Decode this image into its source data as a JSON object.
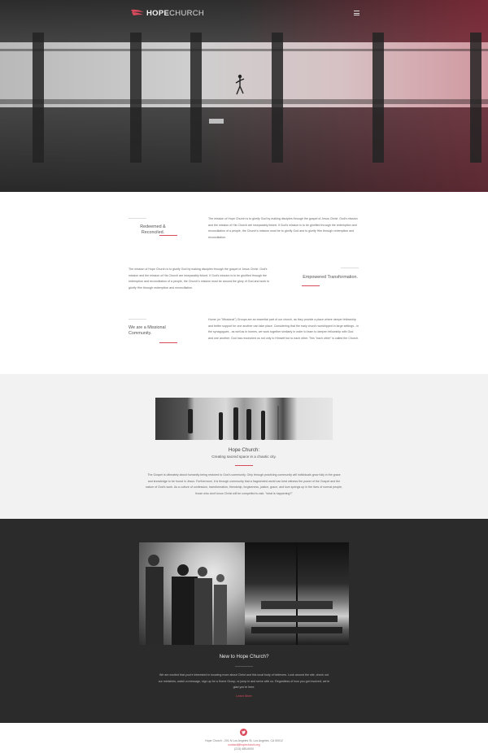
{
  "brand": {
    "name_bold": "HOPE",
    "name_light": "CHURCH",
    "accent": "#d94a5c"
  },
  "nav": {
    "menu_icon": "hamburger-menu-icon"
  },
  "mission": [
    {
      "heading": "Redeemed & Reconciled.",
      "body": "The mission of Hope Church is to glorify God by making disciples through the gospel of Jesus Christ. God's mission and the mission of His Church are inseparably linked. If God's mission is to be glorified through the redemption and reconciliation of a people, the Church's mission must be to glorify God and to glorify Him through redemption and reconciliation."
    },
    {
      "heading": "Empowered Transformation.",
      "body": "The mission of Hope Church is to glorify God by making disciples through the gospel of Jesus Christ. God's mission and the mission of His Church are inseparably linked. If God's mission is to be glorified through the redemption and reconciliation of a people, the Church's mission must be around the glory of God and work to glorify Him through redemption and reconciliation."
    },
    {
      "heading": "We are a Missional Community.",
      "body": "Home (or \"Missional\") Groups are an essential part of our church, as they provide a place where deeper fellowship and better support for one another can take place. Considering that the early church worshipped in large settings - in the synagogues - as well as in homes, we work together similarly in order to learn to deepen fellowship with God and one another. God has reconciled us not only to Himself but to each other. This \"each other\" is called the Church."
    }
  ],
  "hope": {
    "title": "Hope Church:",
    "subtitle": "Creating sacred space in a chaotic city.",
    "body": "The Gospel is ultimately about humanity being restored to God's community. Only through practicing community will individuals grow fully in the grace and knowledge to be found in Jesus. Furthermore, it is through community that a fragmented world can best witness the power of the Gospel and the nature of God's work. As a culture of confession, transformation, friendship, forgiveness, justice, grace, and love springs up in the lives of normal people, those who don't know Christ will be compelled to ask: \"what is happening?\""
  },
  "new": {
    "title": "New to Hope Church?",
    "body": "We are excited that you're interested in knowing more about Christ and this local body of believers. Look around the site, check out our ministries, watch a message, sign up for a Home Group, or jump in and serve with us. Regardless of how you got involved, we're glad you're here.",
    "link": "Learn More"
  },
  "footer": {
    "social_icon": "twitter-icon",
    "address": "Hope Church - 201 N Los Angeles St, Los Angeles, CA 90012",
    "email": "contact@hopechurch.org",
    "phone": "(213) 485-6000"
  }
}
